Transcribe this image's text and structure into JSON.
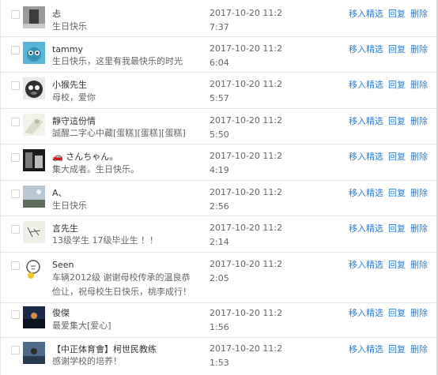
{
  "actions": {
    "pick": "移入精选",
    "reply": "回复",
    "delete": "删除"
  },
  "messages": [
    {
      "name": "忐",
      "text": "生日快乐",
      "time": "2017-10-20 11:27:37"
    },
    {
      "name": "tammy",
      "text": "生日快乐，这里有我最快乐的时光",
      "time": "2017-10-20 11:26:04"
    },
    {
      "name": "小猴先生",
      "text": "母校，爱你",
      "time": "2017-10-20 11:25:57"
    },
    {
      "name": "靜守這份情",
      "text": "誠醒二字心中藏[蛋糕][蛋糕][蛋糕]",
      "time": "2017-10-20 11:25:50"
    },
    {
      "name": "🚗 さんちゃん。",
      "text": "集大成者。生日快乐。",
      "time": "2017-10-20 11:24:19"
    },
    {
      "name": "A、",
      "text": "生日快乐",
      "time": "2017-10-20 11:22:56"
    },
    {
      "name": "言先生",
      "text": "13级学生 17级毕业生 ！！",
      "time": "2017-10-20 11:22:14"
    },
    {
      "name": "Seen",
      "text": "车辆2012级 谢谢母校传承的温良恭俭让，祝母校生日快乐，桃李成行！",
      "time": "2017-10-20 11:22:05"
    },
    {
      "name": "俊傑",
      "text": "最爱集大[爱心]",
      "time": "2017-10-20 11:21:56"
    },
    {
      "name": "【中正体育會】柯世民教练",
      "text": "感谢学校的培养！",
      "time": "2017-10-20 11:21:53"
    }
  ]
}
